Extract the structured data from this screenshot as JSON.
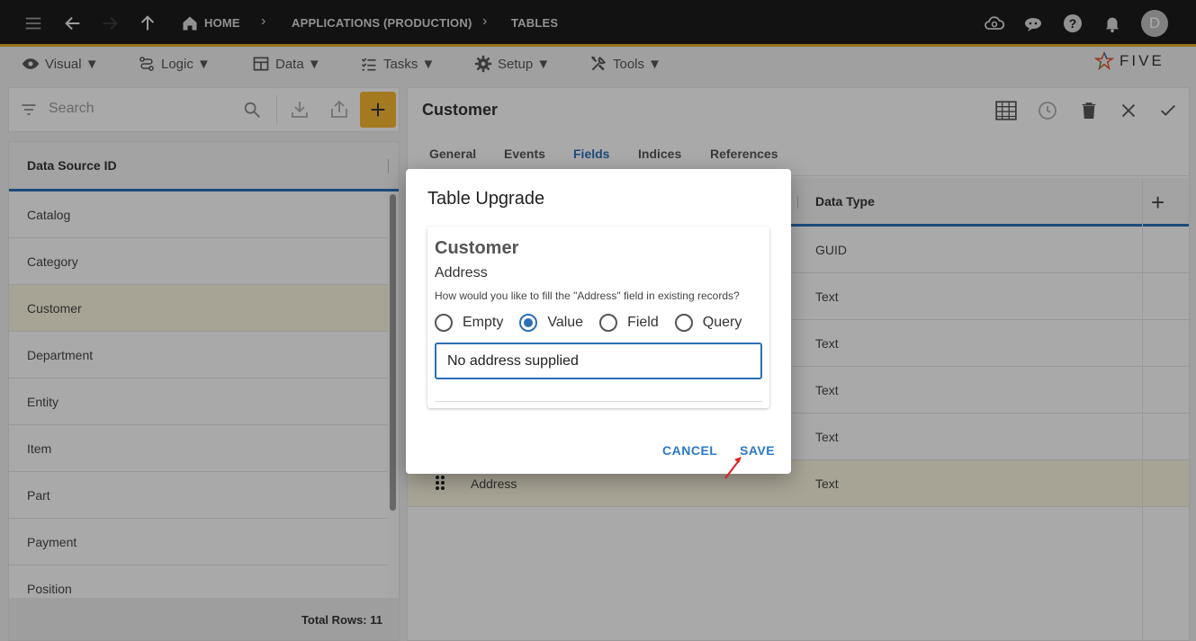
{
  "topbar": {
    "breadcrumbs": [
      "HOME",
      "APPLICATIONS (PRODUCTION)",
      "TABLES"
    ],
    "avatar_initial": "D"
  },
  "menubar": {
    "items": [
      {
        "label": "Visual ▼",
        "icon": "eye-icon"
      },
      {
        "label": "Logic ▼",
        "icon": "logic-icon"
      },
      {
        "label": "Data ▼",
        "icon": "table-icon"
      },
      {
        "label": "Tasks ▼",
        "icon": "checklist-icon"
      },
      {
        "label": "Setup ▼",
        "icon": "gear-icon"
      },
      {
        "label": "Tools ▼",
        "icon": "tools-icon"
      }
    ],
    "brand": "FIVE"
  },
  "left_panel": {
    "search_placeholder": "Search",
    "column_header": "Data Source ID",
    "rows": [
      "Catalog",
      "Category",
      "Customer",
      "Department",
      "Entity",
      "Item",
      "Part",
      "Payment",
      "Position"
    ],
    "selected": "Customer",
    "footer": "Total Rows: 11"
  },
  "right_panel": {
    "title": "Customer",
    "tabs": [
      "General",
      "Events",
      "Fields",
      "Indices",
      "References"
    ],
    "active_tab": "Fields",
    "grid_header": "Data Type",
    "rows": [
      {
        "name": "",
        "type": "GUID"
      },
      {
        "name": "",
        "type": "Text"
      },
      {
        "name": "",
        "type": "Text"
      },
      {
        "name": "",
        "type": "Text"
      },
      {
        "name": "",
        "type": "Text"
      },
      {
        "name": "Address",
        "type": "Text"
      }
    ]
  },
  "dialog": {
    "title": "Table Upgrade",
    "table_name": "Customer",
    "field_name": "Address",
    "question": "How would you like to fill the \"Address\" field in existing records?",
    "options": [
      "Empty",
      "Value",
      "Field",
      "Query"
    ],
    "selected_option": "Value",
    "value": "No address supplied",
    "cancel_label": "CANCEL",
    "save_label": "SAVE"
  },
  "colors": {
    "accent": "#2c6fb5",
    "brand_yellow": "#f2b431",
    "topbar": "#1b1b1b",
    "annotation_arrow": "#e02020"
  }
}
